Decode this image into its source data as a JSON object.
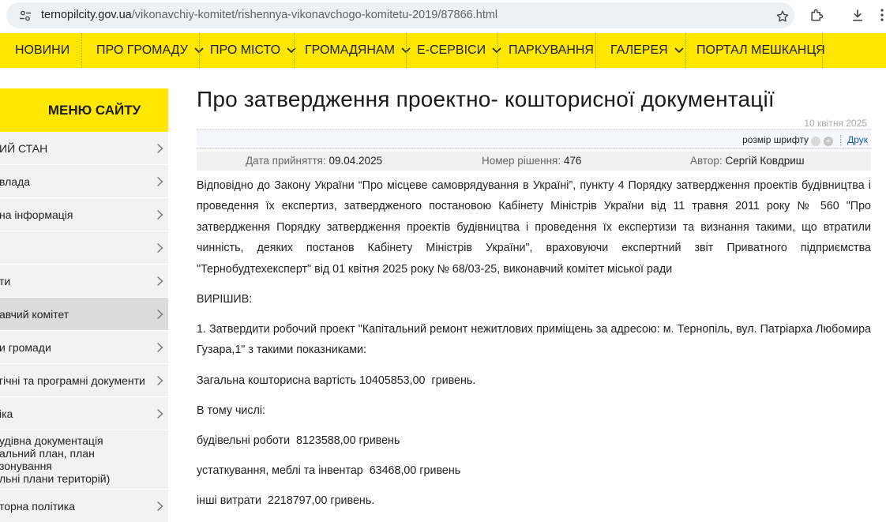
{
  "browser": {
    "url_host": "ternopilcity.gov.ua",
    "url_path": "/vikonavchiy-komitet/rishennya-vikonavchogo-komitetu-2019/87866.html"
  },
  "nav": {
    "items": [
      {
        "label": "НОВИНИ",
        "dropdown": false
      },
      {
        "label": "ПРО ГРОМАДУ",
        "dropdown": true
      },
      {
        "label": "ПРО МІСТО",
        "dropdown": true
      },
      {
        "label": "ГРОМАДЯНАМ",
        "dropdown": true
      },
      {
        "label": "Е-СЕРВІСИ",
        "dropdown": true
      },
      {
        "label": "ПАРКУВАННЯ",
        "dropdown": false
      },
      {
        "label": "ГАЛЕРЕЯ",
        "dropdown": true
      },
      {
        "label": "ПОРТАЛ МЕШКАНЦЯ",
        "dropdown": false
      }
    ]
  },
  "sidebar": {
    "title": "МЕНЮ САЙТУ",
    "items": [
      {
        "label": "ИЙ СТАН"
      },
      {
        "label": "влада"
      },
      {
        "label": "на інформація"
      },
      {
        "label": ""
      },
      {
        "label": "ти"
      },
      {
        "label": "авчий комітет",
        "active": true
      },
      {
        "label": "и громади"
      },
      {
        "label": "гічні та програмні документи"
      },
      {
        "label": "іка"
      },
      {
        "label": "удівна документація\nальний план, план зонування\nльні плани територій)"
      },
      {
        "label": "торна політика"
      }
    ]
  },
  "article": {
    "title": "Про затвердження проектно- кошторисної документації",
    "date": "10 квітня 2025",
    "font_size_label": "розмір шрифту",
    "print_label": "Друк",
    "meta": {
      "adopted_label": "Дата прийняття:",
      "adopted_value": "09.04.2025",
      "number_label": "Номер рішення:",
      "number_value": "476",
      "author_label": "Автор:",
      "author_value": "Сергій Ковдриш"
    },
    "para1": "Відповідно до Закону  України “Про місцеве самоврядування в Україні”, пункту 4 Порядку затвердження проектів будівництва і проведення їх експертиз, затвердженого постановою Кабінету Міністрів України від 11 травня 2011 року № 560 \"Про затвердження Порядку затвердження проектів будівництва і проведення їх експертизи та визнання такими, що втратили чинність, деяких постанов Кабінету Міністрів України\", враховуючи експертний звіт Приватного підприємства \"Тернобудтехексперт\" від 01 квітня 2025 року № 68/03-25, виконавчий комітет міської ради",
    "decided": "ВИРІШИВ:",
    "point1": "1. Затвердити робочий проект \"Капітальний ремонт нежитлових приміщень за адресою: м. Тернопіль, вул. Патріарха Любомира Гузара,1\" з такими показниками:",
    "total": "Загальна кошторисна вартість 10405853,00  гривень.",
    "including": "В тому числі:",
    "construction": "будівельні роботи  8123588,00 гривень",
    "equipment": "устаткування, меблі та інвентар  63468,00 гривень",
    "other": "інші витрати  2218797,00 гривень."
  }
}
